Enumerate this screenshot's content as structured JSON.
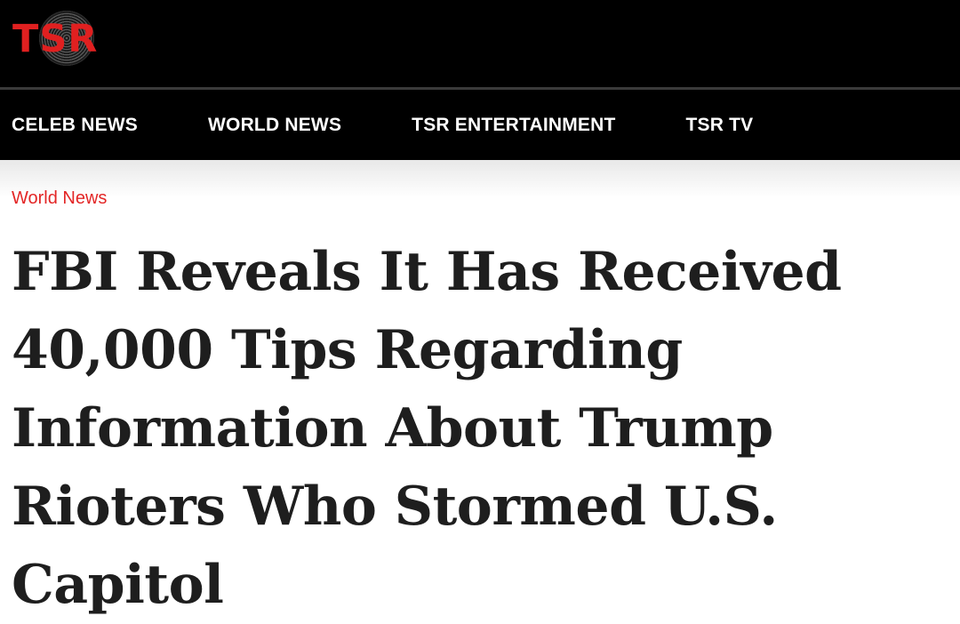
{
  "header": {
    "logo_text": "TSR",
    "brand_color": "#e02020",
    "background": "#000000"
  },
  "nav": {
    "items": [
      {
        "label": "CELEB NEWS"
      },
      {
        "label": "WORLD NEWS"
      },
      {
        "label": "TSR ENTERTAINMENT"
      },
      {
        "label": "TSR TV"
      }
    ]
  },
  "article": {
    "category": "World News",
    "category_color": "#e32626",
    "headline": "FBI Reveals It Has Received 40,000 Tips Regarding Information About Trump Rioters Who Stormed U.S. Capitol"
  }
}
